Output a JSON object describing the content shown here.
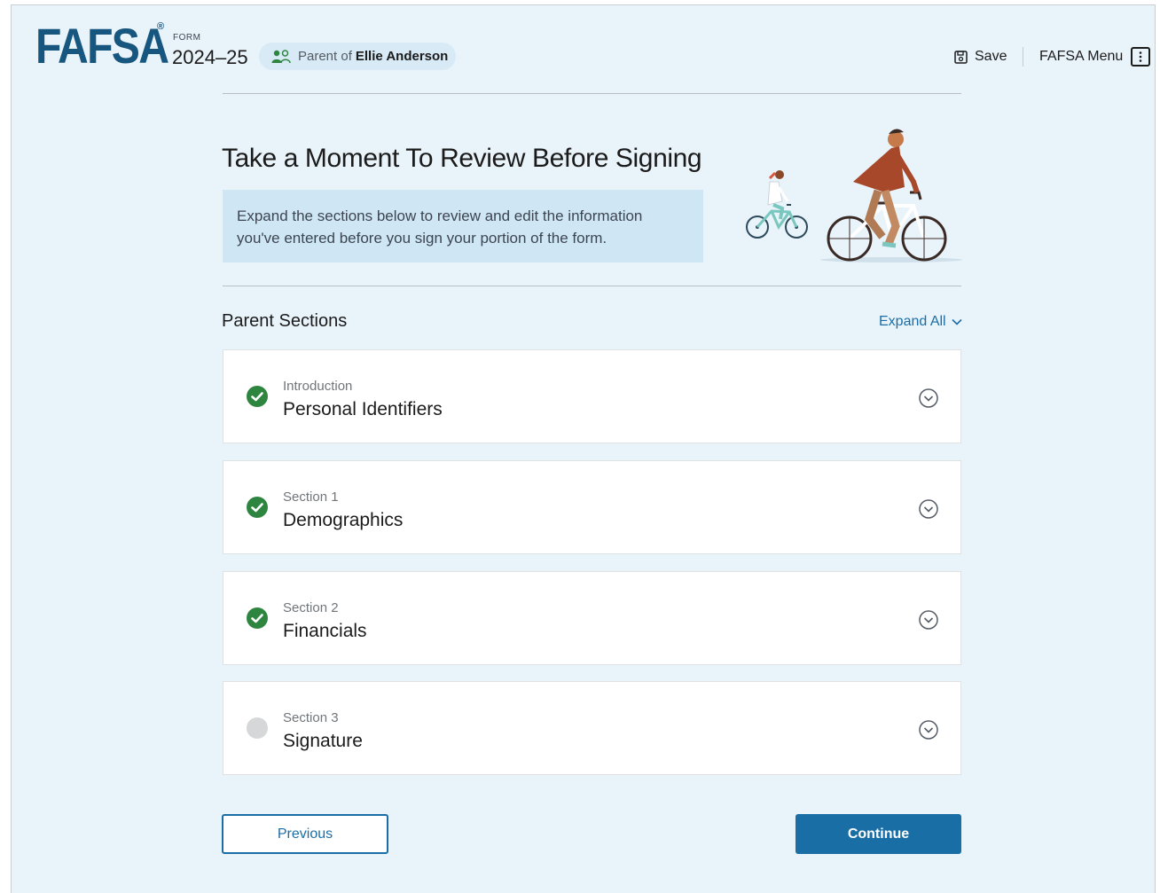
{
  "header": {
    "logo": "FAFSA",
    "logo_mark": "®",
    "form_label": "FORM",
    "form_year": "2024–25",
    "role_prefix": "Parent of",
    "role_name": "Ellie Anderson",
    "save_label": "Save",
    "menu_label": "FAFSA Menu"
  },
  "intro": {
    "title": "Take a Moment To Review Before Signing",
    "description": "Expand the sections below to review and edit the information you've entered before you sign your portion of the form."
  },
  "sections": {
    "heading": "Parent Sections",
    "expand_all_label": "Expand All",
    "items": [
      {
        "eyebrow": "Introduction",
        "name": "Personal Identifiers",
        "status": "complete"
      },
      {
        "eyebrow": "Section 1",
        "name": "Demographics",
        "status": "complete"
      },
      {
        "eyebrow": "Section 2",
        "name": "Financials",
        "status": "complete"
      },
      {
        "eyebrow": "Section 3",
        "name": "Signature",
        "status": "incomplete"
      }
    ]
  },
  "actions": {
    "previous_label": "Previous",
    "continue_label": "Continue"
  },
  "colors": {
    "brand": "#16567f",
    "accent": "#1a6ea6",
    "complete": "#2e8540",
    "incomplete": "#d6d7d9",
    "background": "#e9f3fa"
  },
  "icons": {
    "role": "users-icon",
    "save": "save-icon",
    "menu": "kebab-menu-icon",
    "expand": "chevron-down-icon",
    "complete": "check-circle-icon",
    "incomplete": "empty-circle-icon",
    "section_toggle": "chevron-circle-down-icon"
  }
}
